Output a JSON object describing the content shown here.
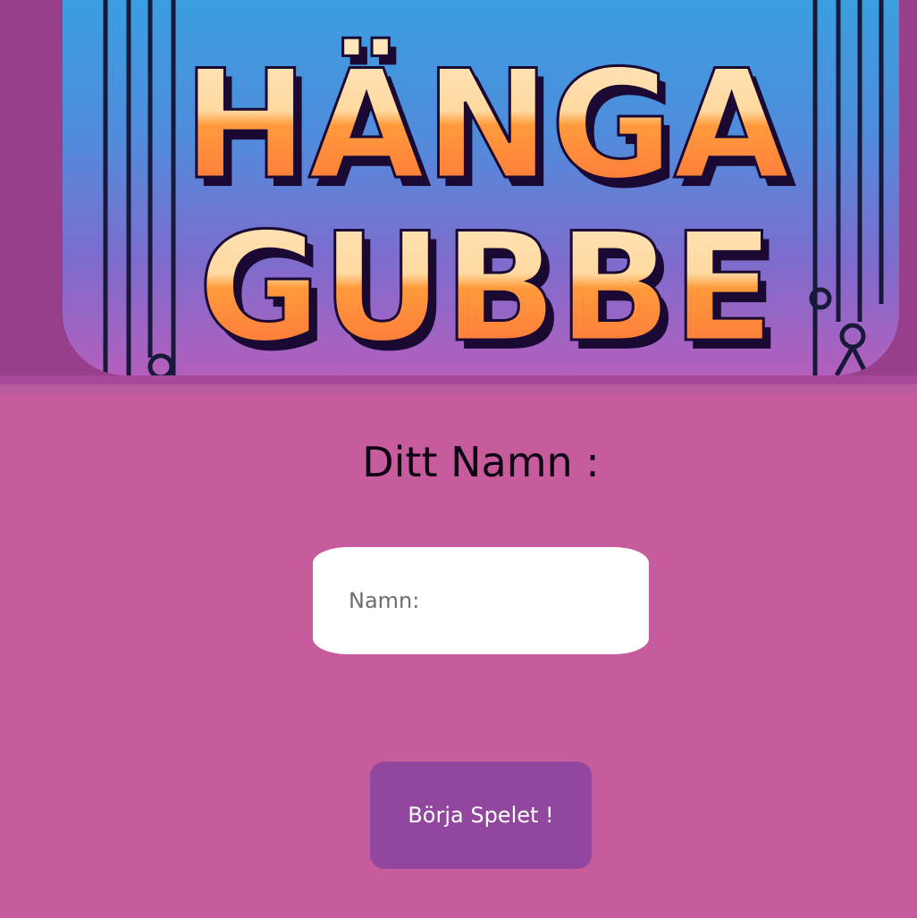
{
  "app": {
    "title": "HÄNGA GUBBE"
  },
  "banner": {
    "line1": "HÄNGA",
    "line2": "GUBBE"
  },
  "form": {
    "heading": "Ditt Namn :",
    "name_placeholder": "Namn:",
    "name_value": "",
    "start_label": "Börja Spelet !"
  },
  "colors": {
    "page_background": "#c65c9b",
    "header_background": "#983f8b",
    "button_background": "#91479e",
    "title_orange": "#ff8a3a",
    "title_cream": "#ffe2b0",
    "title_outline": "#1a0a33"
  }
}
